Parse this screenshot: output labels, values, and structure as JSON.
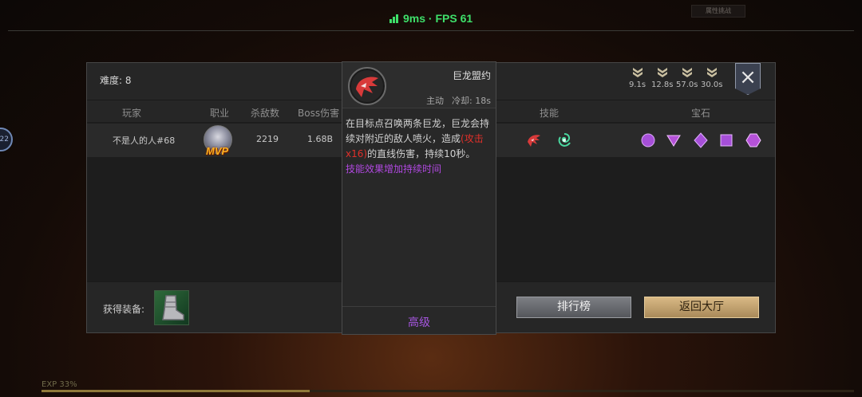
{
  "status": {
    "net": "9ms · FPS 61",
    "top_tag": "属性挑战",
    "side_badge": "22"
  },
  "panel": {
    "difficulty": "难度: 8",
    "buffs": [
      {
        "time": "9.1s",
        "icon": "rank-chevron-icon"
      },
      {
        "time": "12.8s",
        "icon": "rank-chevron-icon"
      },
      {
        "time": "57.0s",
        "icon": "rank-chevron-icon"
      },
      {
        "time": "30.0s",
        "icon": "rank-chevron-icon"
      }
    ],
    "close_icon": "×",
    "columns": {
      "player": "玩家",
      "class": "职业",
      "kills": "杀敌数",
      "boss_damage": "Boss伤害",
      "skills": "技能",
      "gems": "宝石"
    },
    "rows": [
      {
        "name": "不是人的人#68",
        "badge": "MVP",
        "kills": "2219",
        "boss_damage": "1.68B"
      }
    ],
    "skills": [
      "dragon-pact-icon",
      "dragon-swirl-icon"
    ],
    "gems": [
      {
        "shape": "circle",
        "color": "#a64fd8"
      },
      {
        "shape": "triangle",
        "color": "#b552d8"
      },
      {
        "shape": "diamond",
        "color": "#a64fd8"
      },
      {
        "shape": "square",
        "color": "#a64fd8"
      },
      {
        "shape": "hexagon",
        "color": "#b552d8"
      }
    ],
    "equip_label": "获得装备:",
    "buttons": {
      "rank": "排行榜",
      "lobby": "返回大厅"
    }
  },
  "tooltip": {
    "name": "巨龙盟约",
    "type": "主动",
    "cooldown": "冷却: 18s",
    "desc_1": "在目标点召唤两条巨龙，巨龙会持续对附近的敌人喷火，造成",
    "desc_hl": "(攻击x16)",
    "desc_2": "的直线伤害，持续10秒。",
    "desc_ext": "技能效果增加持续时间",
    "grade": "高级"
  },
  "exp": {
    "label": "EXP 33%",
    "fraction": 0.33
  }
}
